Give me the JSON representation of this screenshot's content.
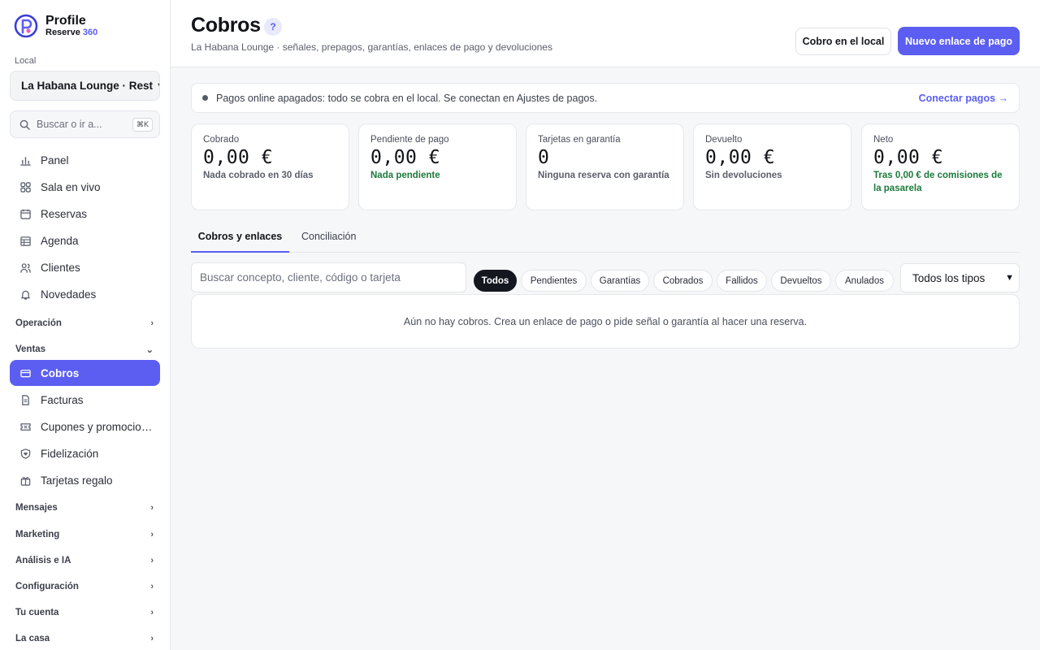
{
  "brand": {
    "name": "Profile",
    "sub_text": "Reserve",
    "sub_num": "360"
  },
  "sidebar": {
    "local_label": "Local",
    "local_value": "La Habana Lounge · Rest",
    "search_placeholder": "Buscar o ir a...",
    "search_shortcut": "⌘K",
    "items": [
      {
        "label": "Panel",
        "icon": "bar-chart-icon"
      },
      {
        "label": "Sala en vivo",
        "icon": "grid-icon"
      },
      {
        "label": "Reservas",
        "icon": "calendar-icon"
      },
      {
        "label": "Agenda",
        "icon": "table-icon"
      },
      {
        "label": "Clientes",
        "icon": "users-icon"
      },
      {
        "label": "Novedades",
        "icon": "bell-icon"
      }
    ],
    "sections": {
      "operacion": "Operación",
      "ventas": "Ventas",
      "mensajes": "Mensajes",
      "marketing": "Marketing",
      "analisis": "Análisis e IA",
      "configuracion": "Configuración",
      "cuenta": "Tu cuenta",
      "casa": "La casa"
    },
    "ventas_items": [
      {
        "label": "Cobros",
        "icon": "credit-card-icon",
        "active": true
      },
      {
        "label": "Facturas",
        "icon": "document-icon"
      },
      {
        "label": "Cupones y promociones",
        "icon": "ticket-icon"
      },
      {
        "label": "Fidelización",
        "icon": "heart-shield-icon"
      },
      {
        "label": "Tarjetas regalo",
        "icon": "gift-icon"
      }
    ]
  },
  "header": {
    "title": "Cobros",
    "help": "?",
    "subtitle": "La Habana Lounge · señales, prepagos, garantías, enlaces de pago y devoluciones",
    "btn_local": "Cobro en el local",
    "btn_new": "Nuevo enlace de pago"
  },
  "banner": {
    "text": "Pagos online apagados: todo se cobra en el local. Se conectan en Ajustes de pagos.",
    "link": "Conectar pagos →"
  },
  "cards": [
    {
      "label": "Cobrado",
      "value": "0,00 €",
      "note": "Nada cobrado en 30 días"
    },
    {
      "label": "Pendiente de pago",
      "value": "0,00 €",
      "note": "Nada pendiente"
    },
    {
      "label": "Tarjetas en garantía",
      "value": "0",
      "note": "Ninguna reserva con garantía"
    },
    {
      "label": "Devuelto",
      "value": "0,00 €",
      "note": "Sin devoluciones"
    },
    {
      "label": "Neto",
      "value": "0,00 €",
      "note": "Tras 0,00 € de comisiones de la pasarela"
    }
  ],
  "tabs": [
    "Cobros y enlaces",
    "Conciliación"
  ],
  "filters": {
    "search_placeholder": "Buscar concepto, cliente, código o tarjeta",
    "chips": [
      "Todos",
      "Pendientes",
      "Garantías",
      "Cobrados",
      "Fallidos",
      "Devueltos",
      "Anulados"
    ],
    "type_select": "Todos los tipos"
  },
  "empty_text": "Aún no hay cobros. Crea un enlace de pago o pide señal o garantía al hacer una reserva.",
  "colors": {
    "accent": "#5b5ef0",
    "positive": "#1b7a3a",
    "dark_chip": "#141720"
  }
}
